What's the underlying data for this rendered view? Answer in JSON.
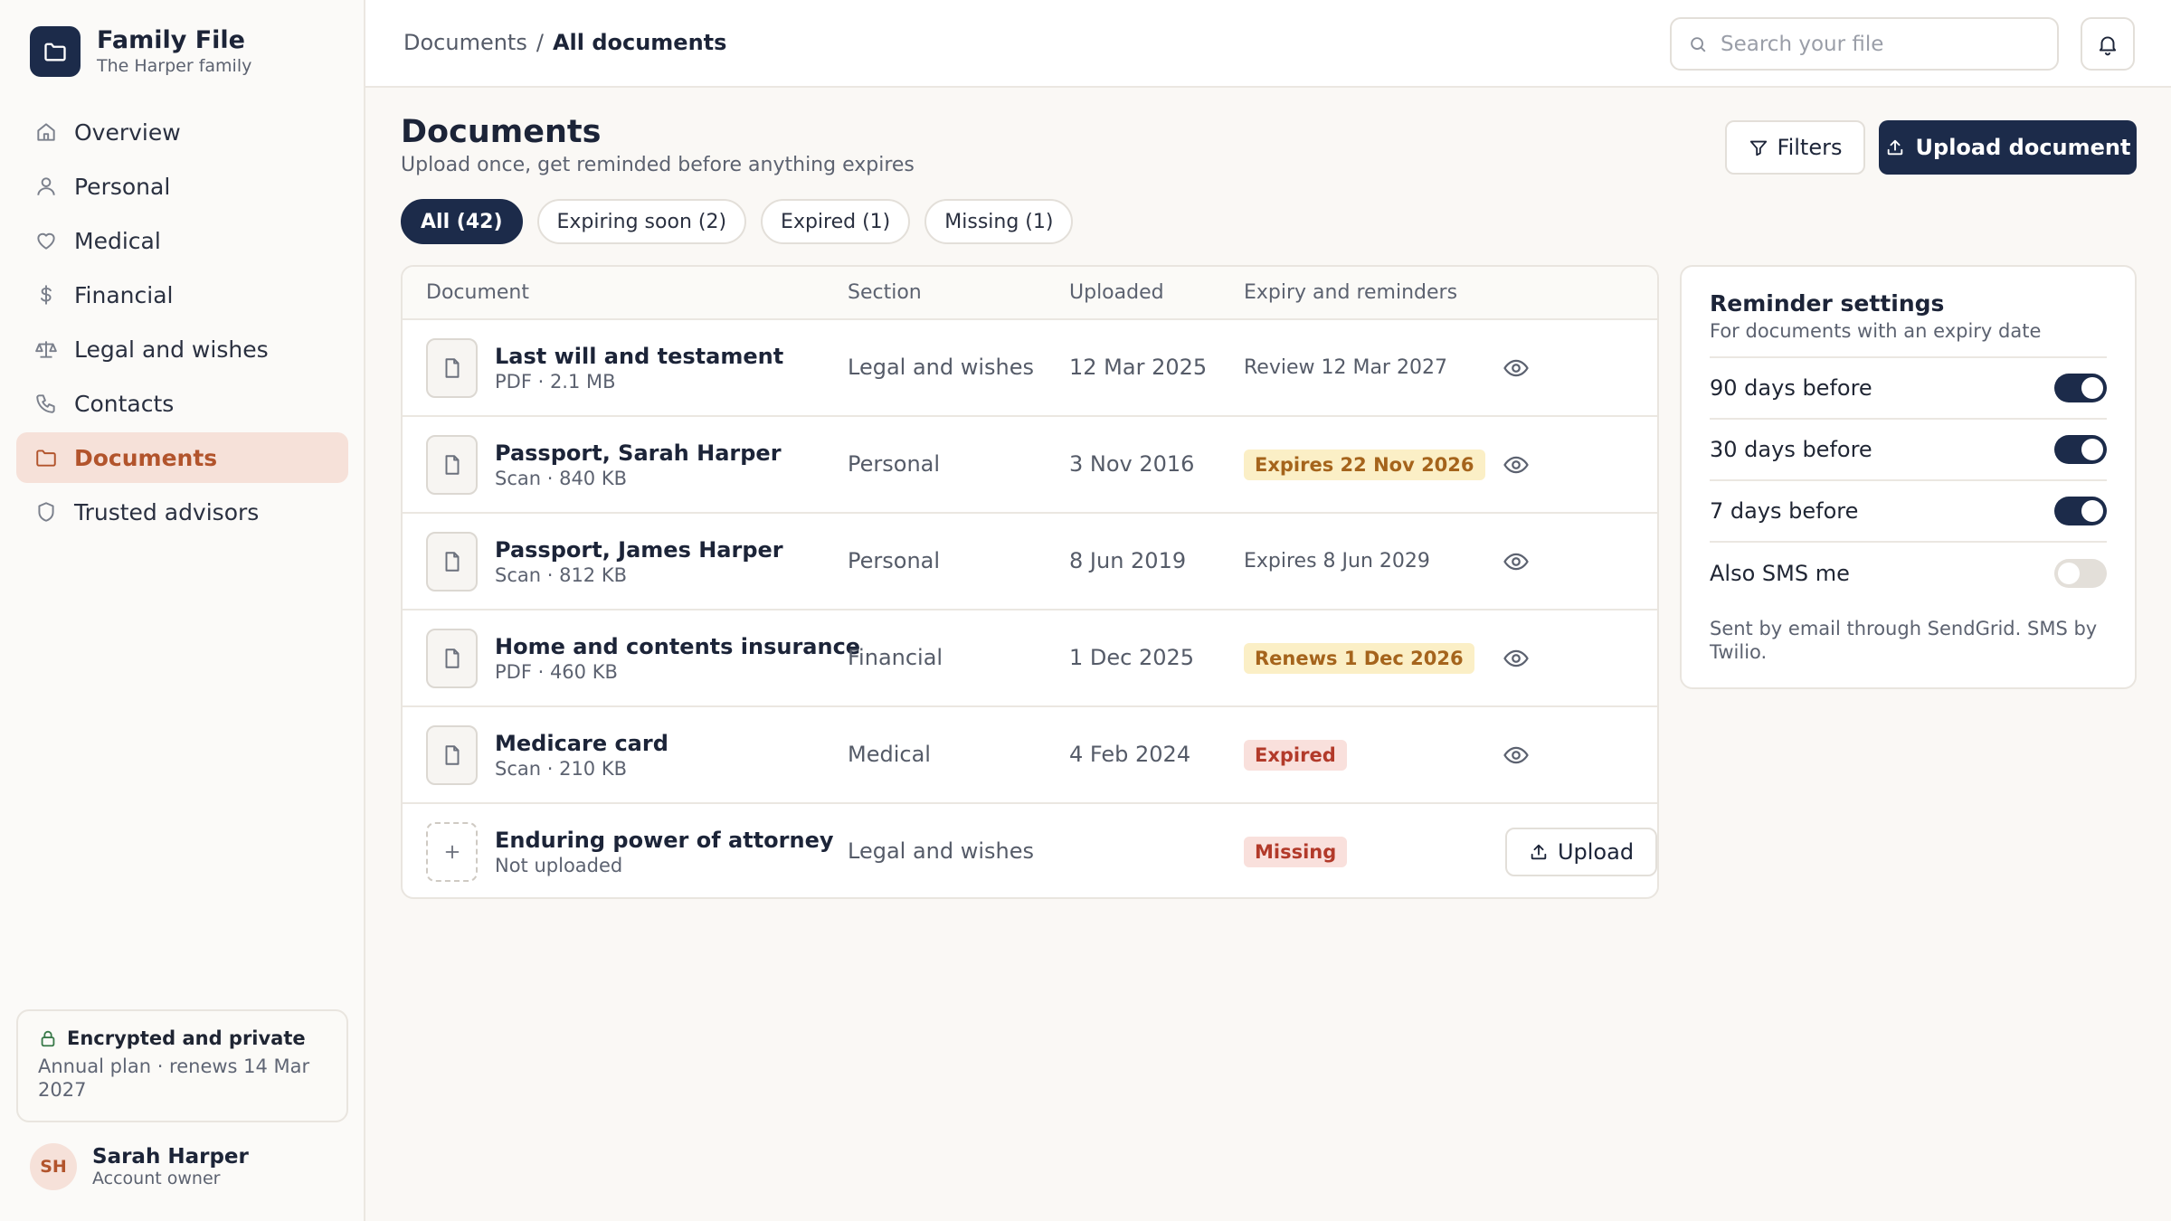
{
  "brand": {
    "title": "Family File",
    "subtitle": "The Harper family"
  },
  "nav": [
    {
      "label": "Overview",
      "icon": "home-icon"
    },
    {
      "label": "Personal",
      "icon": "user-icon"
    },
    {
      "label": "Medical",
      "icon": "heart-icon"
    },
    {
      "label": "Financial",
      "icon": "dollar-icon"
    },
    {
      "label": "Legal and wishes",
      "icon": "scales-icon"
    },
    {
      "label": "Contacts",
      "icon": "phone-icon"
    },
    {
      "label": "Documents",
      "icon": "folder-icon",
      "active": true
    },
    {
      "label": "Trusted advisors",
      "icon": "shield-icon"
    }
  ],
  "security": {
    "title": "Encrypted and private",
    "subtitle": "Annual plan · renews 14 Mar 2027"
  },
  "user": {
    "initials": "SH",
    "name": "Sarah Harper",
    "role": "Account owner"
  },
  "breadcrumb": {
    "parent": "Documents",
    "separator": "/",
    "current": "All documents"
  },
  "search": {
    "placeholder": "Search your file"
  },
  "page": {
    "title": "Documents",
    "subtitle": "Upload once, get reminded before anything expires"
  },
  "actions": {
    "filters": "Filters",
    "upload": "Upload document"
  },
  "chips": [
    "All (42)",
    "Expiring soon (2)",
    "Expired (1)",
    "Missing (1)"
  ],
  "table": {
    "headers": {
      "document": "Document",
      "section": "Section",
      "uploaded": "Uploaded",
      "expiry": "Expiry and reminders"
    },
    "rows": [
      {
        "name": "Last will and testament",
        "meta": "PDF · 2.1 MB",
        "section": "Legal and wishes",
        "uploaded": "12 Mar 2025",
        "expiry": "Review 12 Mar 2027",
        "status": "plain"
      },
      {
        "name": "Passport, Sarah Harper",
        "meta": "Scan · 840 KB",
        "section": "Personal",
        "uploaded": "3 Nov 2016",
        "expiry": "Expires 22 Nov 2026",
        "status": "amber"
      },
      {
        "name": "Passport, James Harper",
        "meta": "Scan · 812 KB",
        "section": "Personal",
        "uploaded": "8 Jun 2019",
        "expiry": "Expires 8 Jun 2029",
        "status": "plain"
      },
      {
        "name": "Home and contents insurance",
        "meta": "PDF · 460 KB",
        "section": "Financial",
        "uploaded": "1 Dec 2025",
        "expiry": "Renews 1 Dec 2026",
        "status": "amber"
      },
      {
        "name": "Medicare card",
        "meta": "Scan · 210 KB",
        "section": "Medical",
        "uploaded": "4 Feb 2024",
        "expiry": "Expired",
        "status": "red"
      },
      {
        "name": "Enduring power of attorney",
        "meta": "Not uploaded",
        "section": "Legal and wishes",
        "uploaded": "",
        "expiry": "Missing",
        "status": "red",
        "action": "Upload"
      }
    ]
  },
  "reminders": {
    "title": "Reminder settings",
    "subtitle": "For documents with an expiry date",
    "options": [
      {
        "label": "90 days before",
        "on": true
      },
      {
        "label": "30 days before",
        "on": true
      },
      {
        "label": "7 days before",
        "on": true
      },
      {
        "label": "Also SMS me",
        "on": false
      }
    ],
    "note": "Sent by email through SendGrid. SMS by Twilio."
  },
  "colors": {
    "navy": "#1c2b4a",
    "accent": "#b2542c",
    "amber_bg": "#fbefc6",
    "red_bg": "#f9e0dc"
  }
}
